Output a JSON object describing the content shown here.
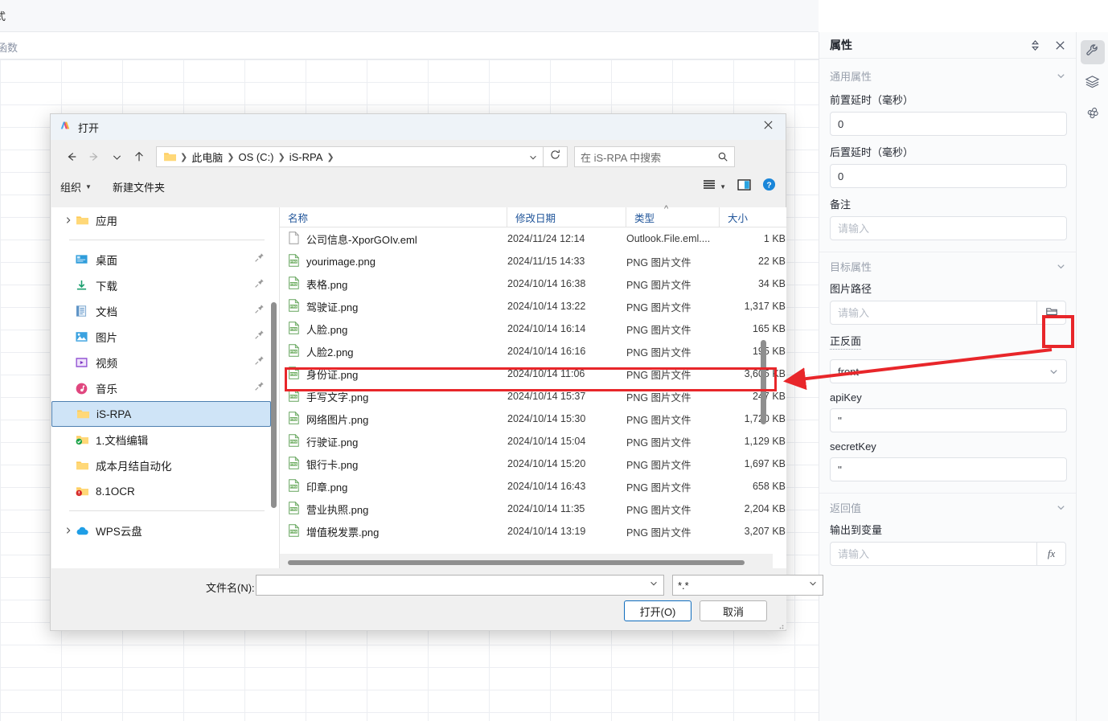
{
  "host": {
    "ribbon_label": "式",
    "formula_label": "函数"
  },
  "properties_panel": {
    "title": "属性",
    "sections": [
      {
        "title": "通用属性"
      },
      {
        "title": "目标属性"
      },
      {
        "title": "返回值"
      }
    ],
    "fields": {
      "pre_delay_label": "前置延时（毫秒）",
      "pre_delay_value": "0",
      "post_delay_label": "后置延时（毫秒）",
      "post_delay_value": "0",
      "remark_label": "备注",
      "remark_placeholder": "请输入",
      "image_path_label": "图片路径",
      "image_path_placeholder": "请输入",
      "side_label": "正反面",
      "side_value": "front",
      "apikey_label": "apiKey",
      "apikey_value": "''",
      "secretkey_label": "secretKey",
      "secretkey_value": "''",
      "output_var_label": "输出到变量",
      "output_var_placeholder": "请输入",
      "fx_label": "fx"
    },
    "rail": [
      {
        "name": "wrench-icon",
        "active": true
      },
      {
        "name": "layers-icon",
        "active": false
      },
      {
        "name": "ai-icon",
        "active": false
      }
    ]
  },
  "dialog": {
    "title": "打开",
    "breadcrumbs": [
      "此电脑",
      "OS (C:)",
      "iS-RPA"
    ],
    "search_placeholder": "在 iS-RPA 中搜索",
    "toolbar": {
      "organize": "组织",
      "new_folder": "新建文件夹"
    },
    "tree": [
      {
        "label": "应用",
        "icon": "folder-icon",
        "expandable": true,
        "pin": false,
        "selected": false,
        "indent": false
      },
      {
        "label": "桌面",
        "icon": "desktop-icon",
        "expandable": false,
        "pin": true,
        "selected": false,
        "indent": true
      },
      {
        "label": "下载",
        "icon": "download-icon",
        "expandable": false,
        "pin": true,
        "selected": false,
        "indent": true
      },
      {
        "label": "文档",
        "icon": "document-icon",
        "expandable": false,
        "pin": true,
        "selected": false,
        "indent": true
      },
      {
        "label": "图片",
        "icon": "picture-icon",
        "expandable": false,
        "pin": true,
        "selected": false,
        "indent": true
      },
      {
        "label": "视频",
        "icon": "video-icon",
        "expandable": false,
        "pin": true,
        "selected": false,
        "indent": true
      },
      {
        "label": "音乐",
        "icon": "music-icon",
        "expandable": false,
        "pin": true,
        "selected": false,
        "indent": true
      },
      {
        "label": "iS-RPA",
        "icon": "folder-icon",
        "expandable": false,
        "pin": false,
        "selected": true,
        "indent": true
      },
      {
        "label": "1.文档编辑",
        "icon": "folder-sync-icon",
        "expandable": false,
        "pin": false,
        "selected": false,
        "indent": true
      },
      {
        "label": "成本月结自动化",
        "icon": "folder-icon",
        "expandable": false,
        "pin": false,
        "selected": false,
        "indent": true
      },
      {
        "label": "8.1OCR",
        "icon": "folder-alert-icon",
        "expandable": false,
        "pin": false,
        "selected": false,
        "indent": true
      },
      {
        "label": "WPS云盘",
        "icon": "cloud-icon",
        "expandable": true,
        "pin": false,
        "selected": false,
        "indent": false
      }
    ],
    "columns": [
      "名称",
      "修改日期",
      "类型",
      "大小"
    ],
    "sort_column": "类型",
    "files": [
      {
        "name": "公司信息-XporGOIv.eml",
        "date": "2024/11/24 12:14",
        "type": "Outlook.File.eml....",
        "size": "1 KB",
        "icon": "eml-file-icon",
        "highlight": false
      },
      {
        "name": "yourimage.png",
        "date": "2024/11/15 14:33",
        "type": "PNG 图片文件",
        "size": "22 KB",
        "icon": "png-file-icon",
        "highlight": false
      },
      {
        "name": "表格.png",
        "date": "2024/10/14 16:38",
        "type": "PNG 图片文件",
        "size": "34 KB",
        "icon": "png-file-icon",
        "highlight": false
      },
      {
        "name": "驾驶证.png",
        "date": "2024/10/14 13:22",
        "type": "PNG 图片文件",
        "size": "1,317 KB",
        "icon": "png-file-icon",
        "highlight": false
      },
      {
        "name": "人脸.png",
        "date": "2024/10/14 16:14",
        "type": "PNG 图片文件",
        "size": "165 KB",
        "icon": "png-file-icon",
        "highlight": false
      },
      {
        "name": "人脸2.png",
        "date": "2024/10/14 16:16",
        "type": "PNG 图片文件",
        "size": "195 KB",
        "icon": "png-file-icon",
        "highlight": false
      },
      {
        "name": "身份证.png",
        "date": "2024/10/14 11:06",
        "type": "PNG 图片文件",
        "size": "3,605 KB",
        "icon": "png-file-icon",
        "highlight": true
      },
      {
        "name": "手写文字.png",
        "date": "2024/10/14 15:37",
        "type": "PNG 图片文件",
        "size": "247 KB",
        "icon": "png-file-icon",
        "highlight": false
      },
      {
        "name": "网络图片.png",
        "date": "2024/10/14 15:30",
        "type": "PNG 图片文件",
        "size": "1,720 KB",
        "icon": "png-file-icon",
        "highlight": false
      },
      {
        "name": "行驶证.png",
        "date": "2024/10/14 15:04",
        "type": "PNG 图片文件",
        "size": "1,129 KB",
        "icon": "png-file-icon",
        "highlight": false
      },
      {
        "name": "银行卡.png",
        "date": "2024/10/14 15:20",
        "type": "PNG 图片文件",
        "size": "1,697 KB",
        "icon": "png-file-icon",
        "highlight": false
      },
      {
        "name": "印章.png",
        "date": "2024/10/14 16:43",
        "type": "PNG 图片文件",
        "size": "658 KB",
        "icon": "png-file-icon",
        "highlight": false
      },
      {
        "name": "营业执照.png",
        "date": "2024/10/14 11:35",
        "type": "PNG 图片文件",
        "size": "2,204 KB",
        "icon": "png-file-icon",
        "highlight": false
      },
      {
        "name": "增值税发票.png",
        "date": "2024/10/14 13:19",
        "type": "PNG 图片文件",
        "size": "3,207 KB",
        "icon": "png-file-icon",
        "highlight": false
      }
    ],
    "filename_label": "文件名(N):",
    "filename_value": "",
    "filter_value": "*.*",
    "open_button": "打开(O)",
    "cancel_button": "取消"
  },
  "annotation": {
    "color": "#e8262a"
  }
}
